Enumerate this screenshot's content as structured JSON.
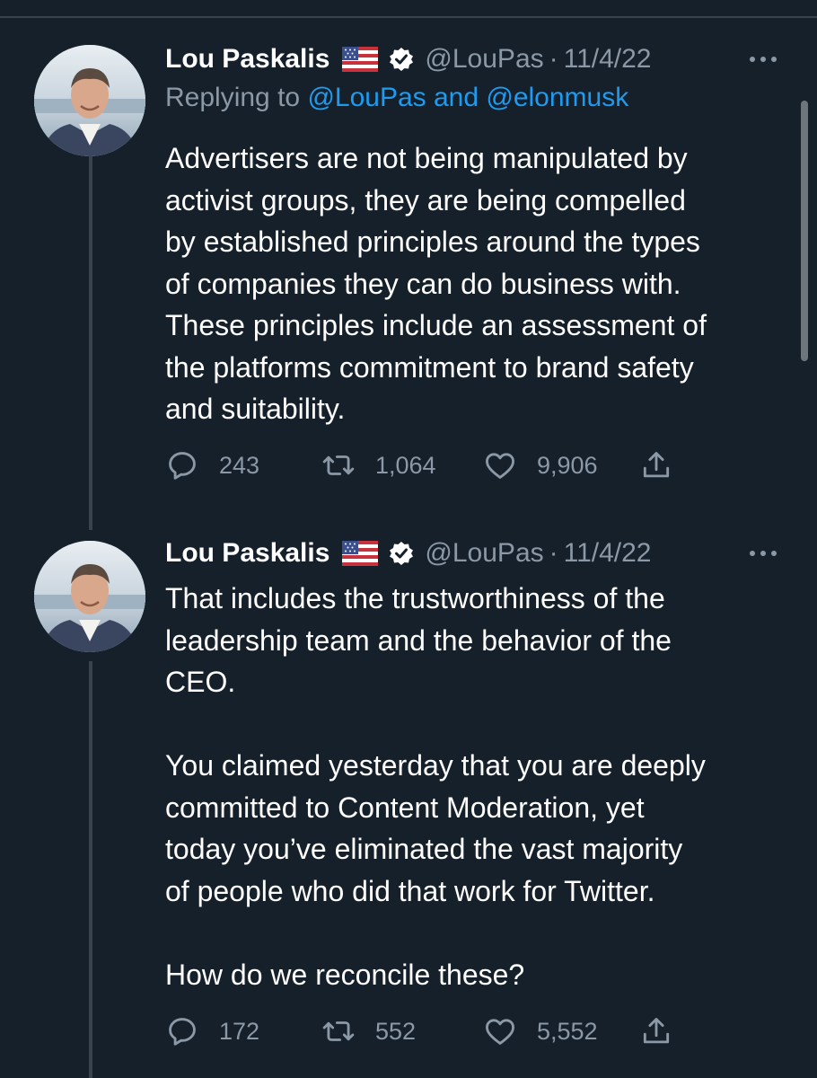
{
  "colors": {
    "background": "#15202b",
    "text": "#ffffff",
    "muted": "#8b98a5",
    "link": "#1d9bf0",
    "thread_line": "#38444d"
  },
  "tweets": [
    {
      "author_name": "Lou Paskalis",
      "flag_icon": "us-flag-icon",
      "verified_icon": "verified-badge-icon",
      "handle": "@LouPas",
      "separator": "·",
      "date": "11/4/22",
      "replying_prefix": "Replying to ",
      "replying_to_1": "@LouPas",
      "replying_and": " and ",
      "replying_to_2": "@elonmusk",
      "text": "Advertisers are not being manipulated by\nactivist groups, they are being compelled\nby established principles around the types\nof companies they can do business with.\nThese principles include an assessment of\nthe platforms commitment to brand safety\nand suitability.",
      "replies": "243",
      "retweets": "1,064",
      "likes": "9,906"
    },
    {
      "author_name": "Lou Paskalis",
      "flag_icon": "us-flag-icon",
      "verified_icon": "verified-badge-icon",
      "handle": "@LouPas",
      "separator": "·",
      "date": "11/4/22",
      "text": "That includes the trustworthiness of the\nleadership team and the behavior of the\nCEO.\n\nYou claimed yesterday that you are deeply\ncommitted to Content Moderation, yet\ntoday you’ve eliminated the vast majority\nof people who did that work for Twitter.\n\nHow do we reconcile these?",
      "replies": "172",
      "retweets": "552",
      "likes": "5,552"
    }
  ]
}
